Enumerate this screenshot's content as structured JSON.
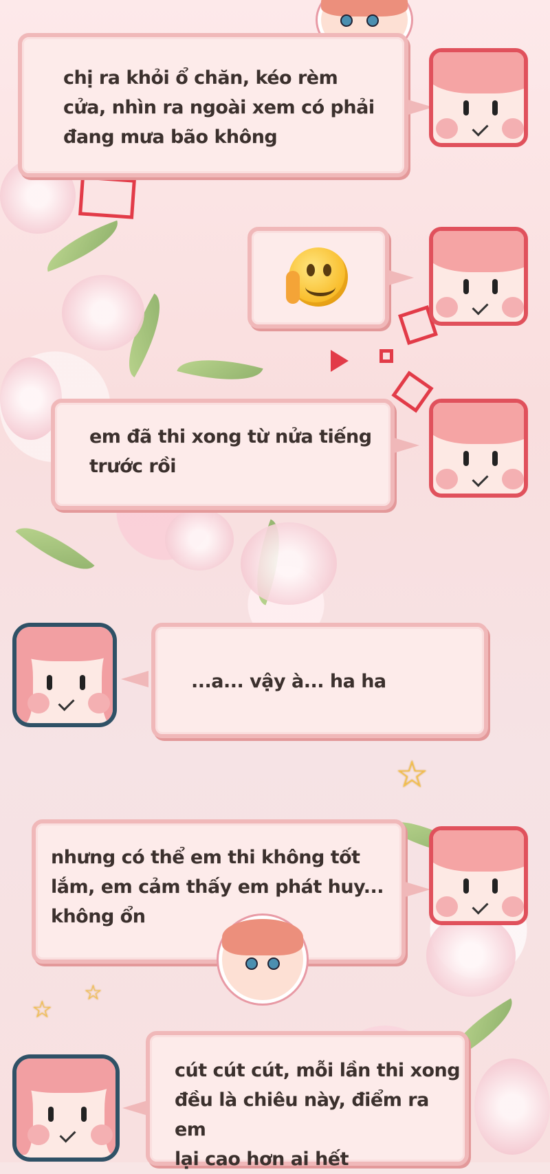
{
  "messages": [
    {
      "sender": "boy",
      "text": "chị ra khỏi ổ chăn, kéo rèm\ncửa, nhìn ra ngoài xem có phải\nđang mưa bão không"
    },
    {
      "sender": "boy",
      "emoji": "thinking-face-emoji"
    },
    {
      "sender": "boy",
      "text": "em đã thi xong từ nửa tiếng\ntrước rồi"
    },
    {
      "sender": "girl",
      "text": "...a... vậy à... ha ha"
    },
    {
      "sender": "boy",
      "text": "nhưng có thể em thi không tốt\nlắm, em cảm thấy em phát huy...\nkhông ổn"
    },
    {
      "sender": "girl",
      "text": "cút cút cút, mỗi lần thi xong\nđều là chiêu này, điểm ra em\nlại cao hơn ai hết"
    }
  ],
  "colors": {
    "bubble_fill": "#fdebea",
    "bubble_border": "#f0b8b9",
    "boy_avatar_border": "#e0515c",
    "girl_avatar_border": "#2f5166",
    "accent_red": "#e23b48"
  }
}
